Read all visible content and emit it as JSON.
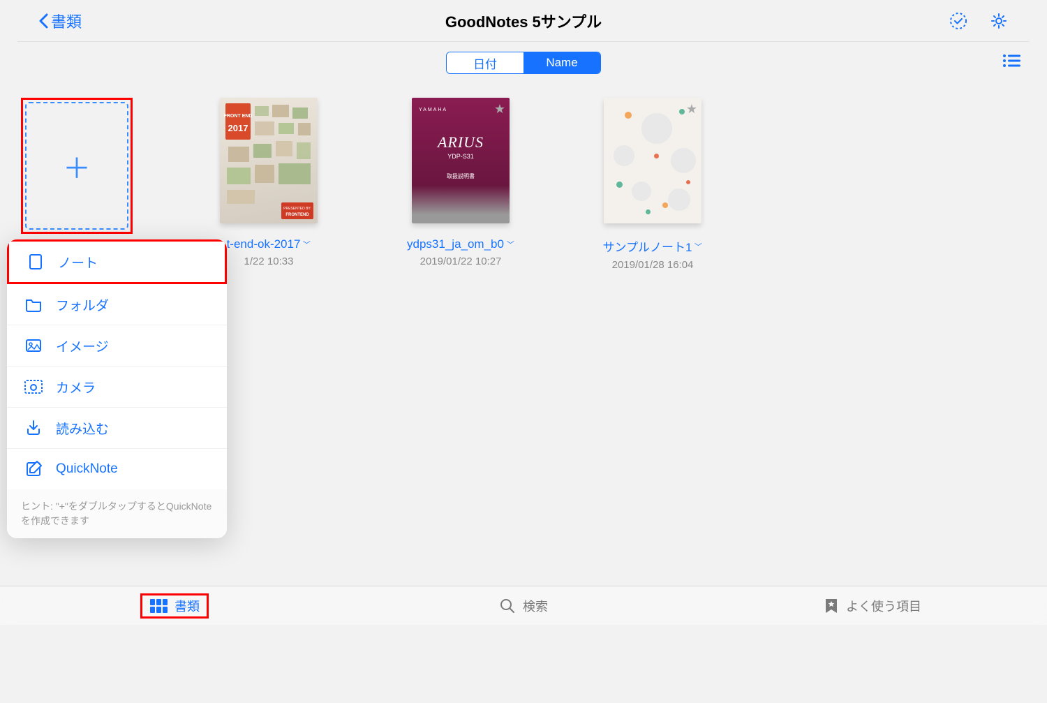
{
  "header": {
    "back": "書類",
    "title": "GoodNotes 5サンプル"
  },
  "sort": {
    "left": "日付",
    "right": "Name"
  },
  "new_item_hint": "+",
  "items": [
    {
      "title": "t-end-ok-2017",
      "date": "1/22 10:33"
    },
    {
      "title": "ydps31_ja_om_b0",
      "date": "2019/01/22 10:27"
    },
    {
      "title": "サンプルノート1",
      "date": "2019/01/28 16:04"
    }
  ],
  "cover3": {
    "brand": "YAMAHA",
    "model": "ARIUS",
    "sub": "YDP-S31",
    "manual": "取扱説明書"
  },
  "menu": {
    "note": "ノート",
    "folder": "フォルダ",
    "image": "イメージ",
    "camera": "カメラ",
    "import": "読み込む",
    "quicknote": "QuickNote",
    "hint": "ヒント: \"+\"をダブルタップするとQuickNoteを作成できます"
  },
  "tabs": {
    "docs": "書類",
    "search": "検索",
    "fav": "よく使う項目"
  }
}
